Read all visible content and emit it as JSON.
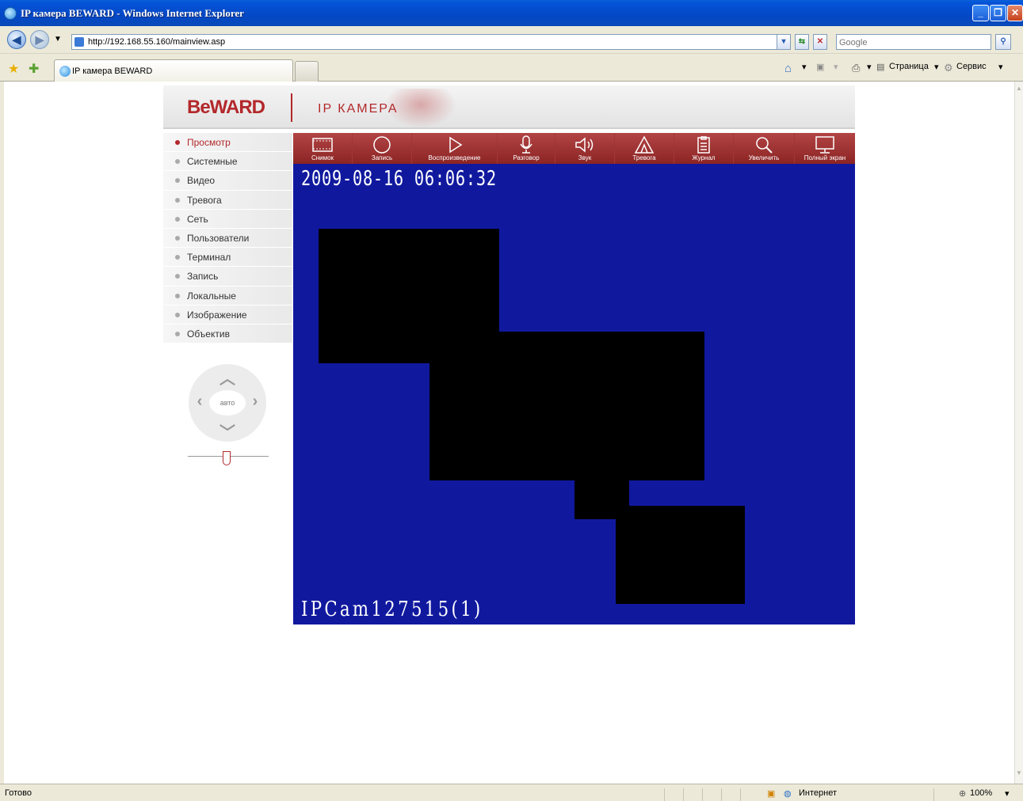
{
  "window": {
    "title": "IP камера BEWARD - Windows Internet Explorer"
  },
  "browser": {
    "address": "http://192.168.55.160/mainview.asp",
    "search_placeholder": "Google",
    "tab_title": "IP камера BEWARD",
    "commands": {
      "page": "Страница",
      "service": "Сервис"
    }
  },
  "page": {
    "logo": "BeWARD",
    "header_title": "IP КАМЕРА",
    "menu": [
      {
        "label": "Просмотр",
        "active": true
      },
      {
        "label": "Системные"
      },
      {
        "label": "Видео"
      },
      {
        "label": "Тревога"
      },
      {
        "label": "Сеть"
      },
      {
        "label": "Пользователи"
      },
      {
        "label": "Терминал"
      },
      {
        "label": "Запись"
      },
      {
        "label": "Локальные"
      },
      {
        "label": "Изображение"
      },
      {
        "label": "Объектив"
      }
    ],
    "ptz": {
      "auto_label": "авто"
    },
    "toolbar": [
      {
        "label": "Снимок",
        "icon": "film-icon"
      },
      {
        "label": "Запись",
        "icon": "record-icon"
      },
      {
        "label": "Воспроизведение",
        "icon": "play-icon"
      },
      {
        "label": "Разговор",
        "icon": "microphone-icon"
      },
      {
        "label": "Звук",
        "icon": "speaker-icon"
      },
      {
        "label": "Тревога",
        "icon": "alarm-icon"
      },
      {
        "label": "Журнал",
        "icon": "clipboard-icon"
      },
      {
        "label": "Увеличить",
        "icon": "zoom-icon"
      },
      {
        "label": "Полный экран",
        "icon": "monitor-icon"
      }
    ],
    "video": {
      "timestamp": "2009-08-16 06:06:32",
      "camera_name": "IPCam127515(1)",
      "background_color": "#10199e"
    }
  },
  "statusbar": {
    "status": "Готово",
    "zone": "Интернет",
    "zoom": "100%"
  },
  "colors": {
    "accent": "#b3282b",
    "xp_titlebar": "#0554d8"
  }
}
